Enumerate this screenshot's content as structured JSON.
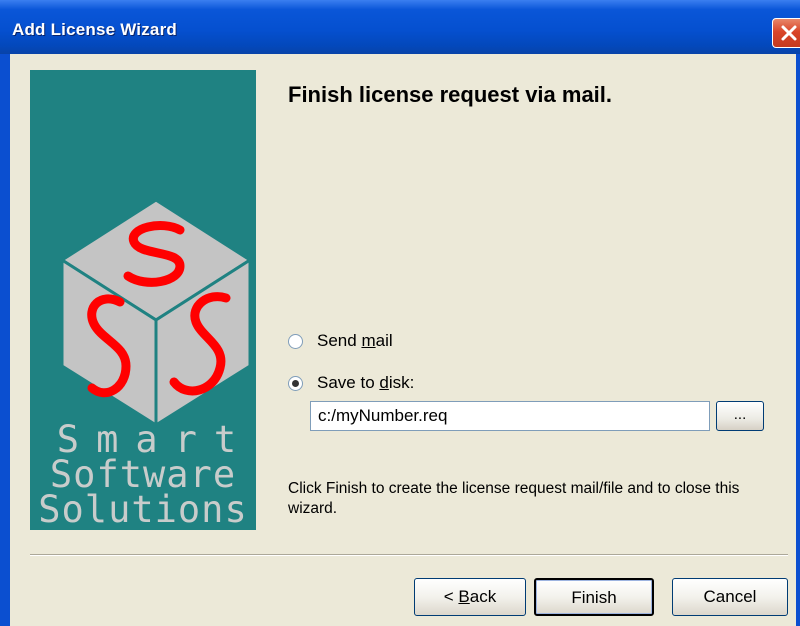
{
  "window": {
    "title": "Add License Wizard",
    "close_icon": "close-x-icon"
  },
  "logo": {
    "icon": "sss-cube-logo-icon",
    "line1": "Smart",
    "line2": "Software",
    "line3": "Solutions",
    "colors": {
      "panel": "#1f8282",
      "cube": "#c0c0c0",
      "letters": "#ff0000",
      "text": "#c8cccb"
    }
  },
  "main": {
    "heading": "Finish license request via mail.",
    "options": [
      {
        "label_pre": "Send ",
        "label_accel": "m",
        "label_post": "ail",
        "selected": false
      },
      {
        "label_pre": "Save to ",
        "label_accel": "d",
        "label_post": "isk:",
        "selected": true
      }
    ],
    "path_value": "c:/myNumber.req",
    "browse_label": "...",
    "info": "Click Finish to create the license request mail/file and to close this wizard."
  },
  "buttons": {
    "back_pre": "< ",
    "back_accel": "B",
    "back_post": "ack",
    "finish": "Finish",
    "cancel": "Cancel"
  }
}
